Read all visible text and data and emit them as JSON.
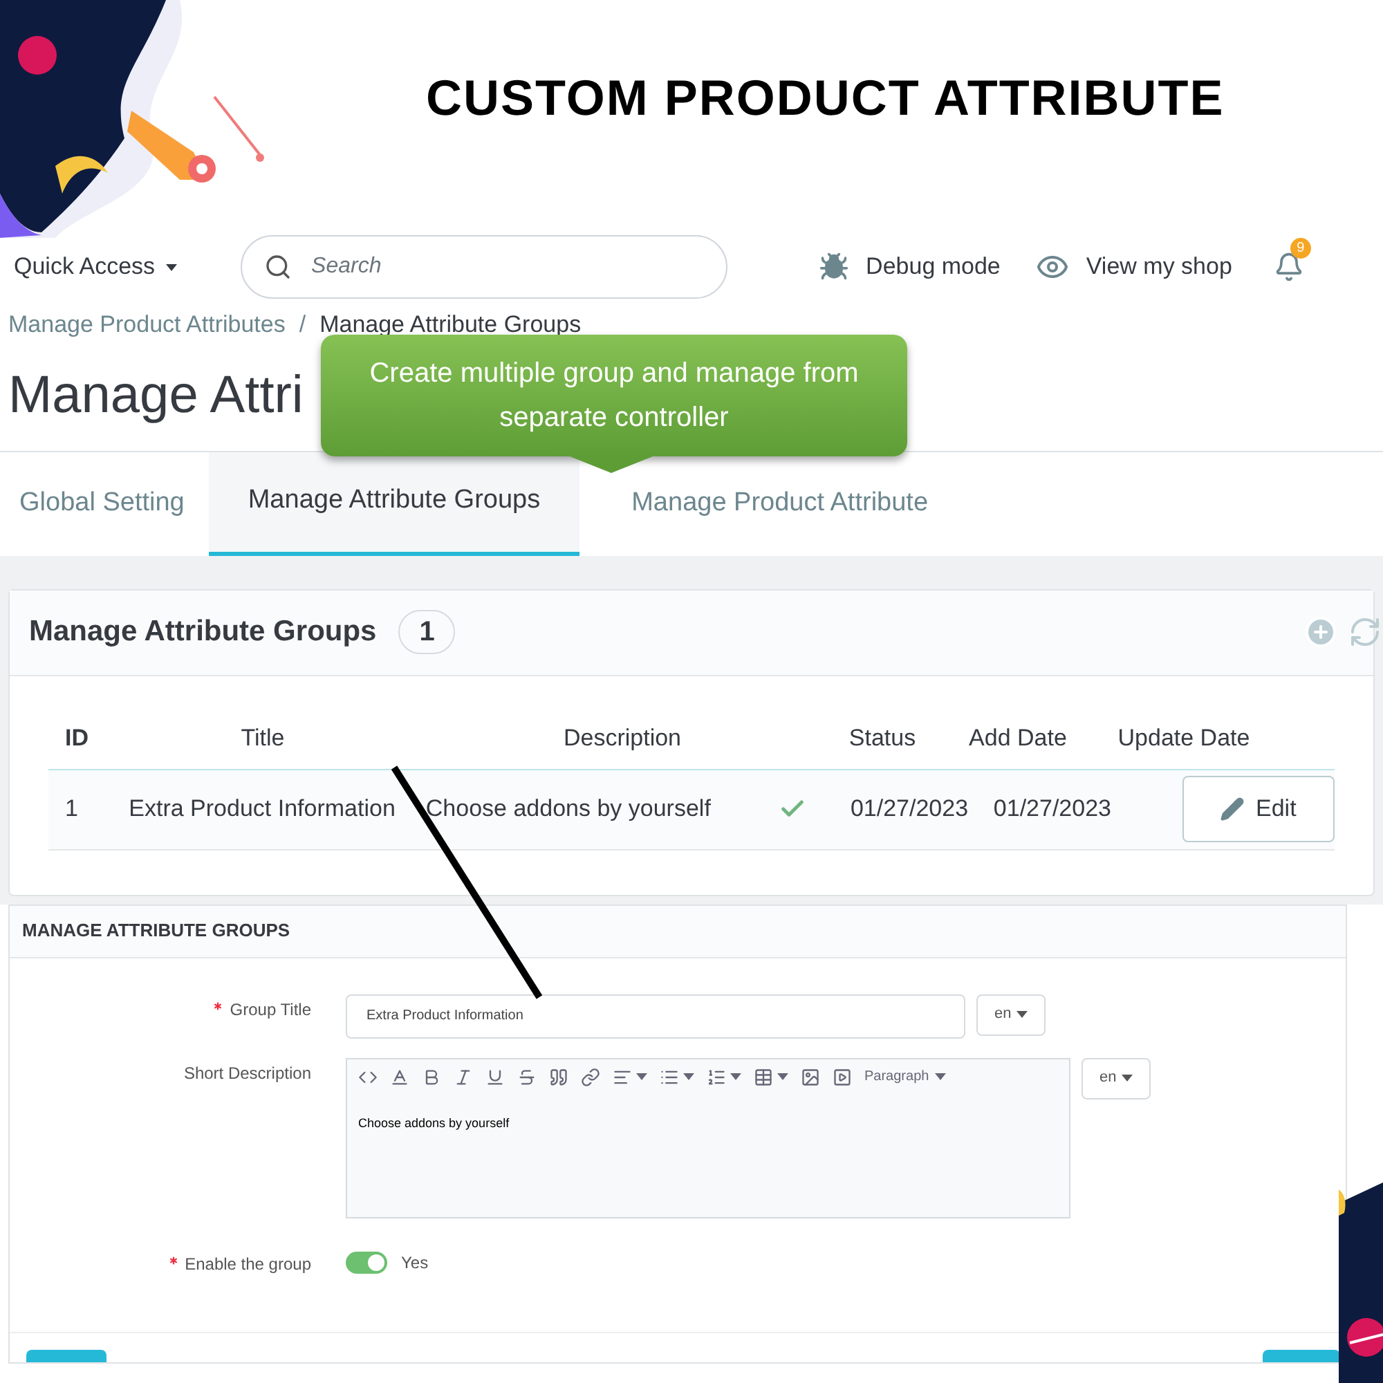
{
  "banner": {
    "title": "CUSTOM PRODUCT ATTRIBUTE"
  },
  "header": {
    "quick_access": "Quick Access",
    "search": {
      "placeholder": "Search"
    },
    "links": [
      {
        "kind": "debug",
        "label": "Debug mode"
      },
      {
        "kind": "shop",
        "label": "View my shop"
      }
    ],
    "notifications": "9"
  },
  "breadcrumb": {
    "items": [
      "Manage Product Attributes",
      "Manage Attribute Groups"
    ],
    "separator": "/"
  },
  "page_title": "Manage Attri",
  "callout": "Create multiple group and manage from separate controller",
  "tabs": [
    {
      "label": "Global Setting",
      "selected": false
    },
    {
      "label": "Manage Attribute Groups",
      "selected": true
    },
    {
      "label": "Manage Product Attribute",
      "selected": false
    }
  ],
  "list_panel": {
    "title": "Manage Attribute Groups",
    "count": "1",
    "columns": [
      "ID",
      "Title",
      "Description",
      "Status",
      "Add Date",
      "Update Date"
    ],
    "rows": [
      {
        "id": "1",
        "title": "Extra Product Information",
        "description": "Choose addons by yourself",
        "status": true,
        "add_date": "01/27/2023",
        "update_date": "01/27/2023",
        "action": "Edit"
      }
    ]
  },
  "form": {
    "title": "MANAGE ATTRIBUTE GROUPS",
    "fields": [
      {
        "kind": "text",
        "label": "Group Title",
        "required": true,
        "value": "Extra Product Information",
        "lang": "en"
      },
      {
        "kind": "editor",
        "label": "Short Description",
        "required": false,
        "format": "Paragraph",
        "value": "Choose addons by yourself",
        "lang": "en"
      },
      {
        "kind": "switch",
        "label": "Enable the group",
        "required": true,
        "on": true,
        "state_label": "Yes"
      }
    ]
  }
}
